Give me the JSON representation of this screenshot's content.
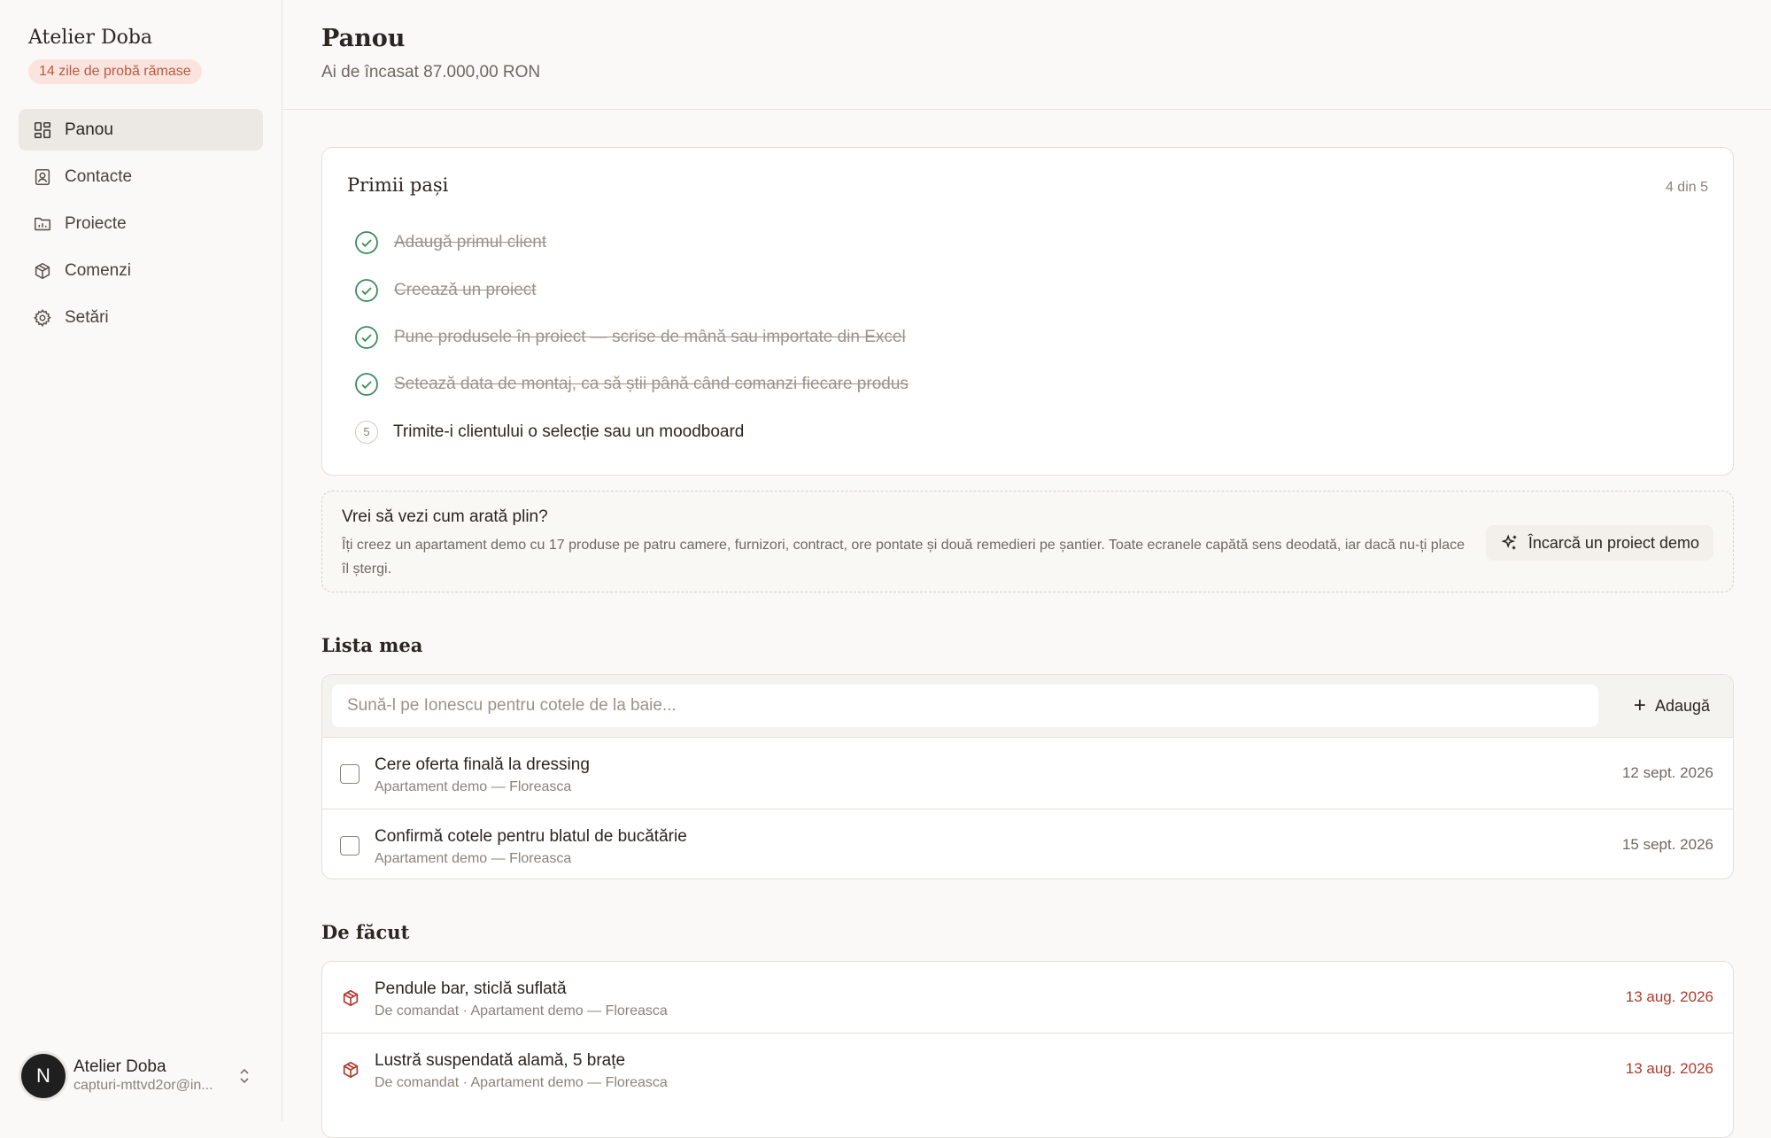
{
  "sidebar": {
    "brand": "Atelier Doba",
    "trial_badge": "14 zile de probă rămase",
    "items": [
      {
        "label": "Panou",
        "icon": "dashboard-icon",
        "active": true
      },
      {
        "label": "Contacte",
        "icon": "contacts-icon"
      },
      {
        "label": "Proiecte",
        "icon": "folder-icon"
      },
      {
        "label": "Comenzi",
        "icon": "package-icon"
      },
      {
        "label": "Setări",
        "icon": "gear-icon"
      }
    ],
    "account": {
      "initial": "N",
      "name": "Atelier Doba",
      "email": "capturi-mttvd2or@in..."
    }
  },
  "header": {
    "title": "Panou",
    "subtitle": "Ai de încasat 87.000,00 RON"
  },
  "first_steps": {
    "title": "Primii pași",
    "progress": "4 din 5",
    "steps": [
      {
        "label": "Adaugă primul client",
        "done": true
      },
      {
        "label": "Creează un proiect",
        "done": true
      },
      {
        "label": "Pune produsele în proiect — scrise de mână sau importate din Excel",
        "done": true
      },
      {
        "label": "Setează data de montaj, ca să știi până când comanzi fiecare produs",
        "done": true
      },
      {
        "label": "Trimite-i clientului o selecție sau un moodboard",
        "done": false,
        "number": "5"
      }
    ]
  },
  "demo": {
    "title": "Vrei să vezi cum arată plin?",
    "text": "Îți creez un apartament demo cu 17 produse pe patru camere, furnizori, contract, ore pontate și două remedieri pe șantier. Toate ecranele capătă sens deodată, iar dacă nu-ți place îl ștergi.",
    "button": "Încarcă un proiect demo"
  },
  "my_list": {
    "title": "Lista mea",
    "placeholder": "Sună-l pe Ionescu pentru cotele de la baie...",
    "add_label": "Adaugă",
    "items": [
      {
        "title": "Cere oferta finală la dressing",
        "project": "Apartament demo — Floreasca",
        "date": "12 sept. 2026"
      },
      {
        "title": "Confirmă cotele pentru blatul de bucătărie",
        "project": "Apartament demo — Floreasca",
        "date": "15 sept. 2026"
      }
    ]
  },
  "todo": {
    "title": "De făcut",
    "items": [
      {
        "title": "Pendule bar, sticlă suflată",
        "meta": "De comandat · Apartament demo — Floreasca",
        "date": "13 aug. 2026"
      },
      {
        "title": "Lustră suspendată alamă, 5 brațe",
        "meta": "De comandat · Apartament demo — Floreasca",
        "date": "13 aug. 2026"
      }
    ]
  },
  "colors": {
    "accent_green": "#3d8c5c",
    "overdue_red": "#b03a2e",
    "badge_bg": "#fbe4dd"
  }
}
